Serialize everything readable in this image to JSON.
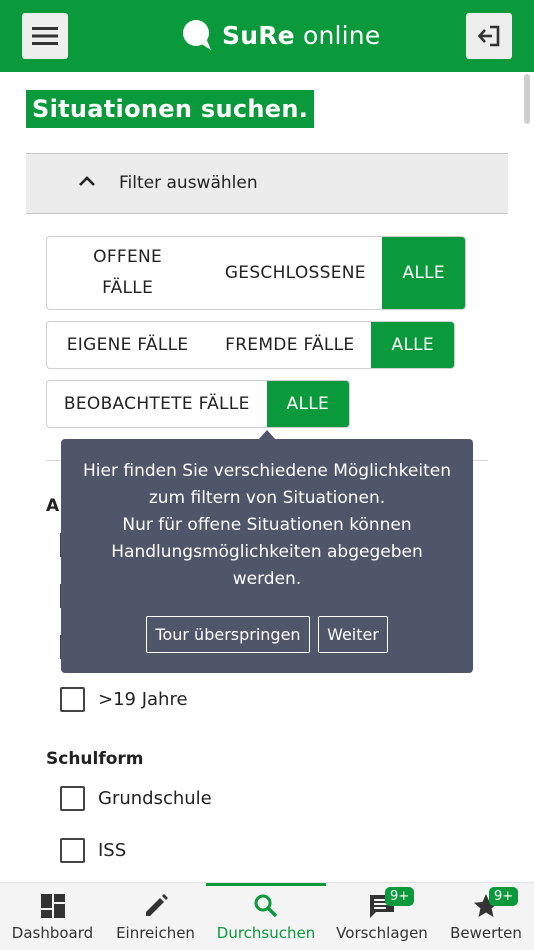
{
  "header": {
    "brand_bold": "SuRe",
    "brand_rest": " online"
  },
  "page": {
    "title": "Situationen suchen."
  },
  "filter": {
    "label": "Filter auswählen",
    "group1": [
      "OFFENE\nFÄLLE",
      "GESCHLOSSENE",
      "ALLE"
    ],
    "group2": [
      "EIGENE FÄLLE",
      "FREMDE FÄLLE",
      "ALLE"
    ],
    "group3": [
      "BEOBACHTETE FÄLLE",
      "ALLE"
    ]
  },
  "age_section": {
    "title_visible": "A",
    "last_option": ">19 Jahre"
  },
  "schulform": {
    "title": "Schulform",
    "options": [
      "Grundschule",
      "ISS"
    ]
  },
  "tooltip": {
    "line1": "Hier finden Sie verschiedene Möglichkeiten",
    "line2": "zum filtern von Situationen.",
    "line3": "Nur für offene Situationen können",
    "line4": "Handlungsmöglichkeiten abgegeben",
    "line5": "werden.",
    "skip_label": "Tour überspringen",
    "next_label": "Weiter"
  },
  "nav": {
    "items": [
      {
        "label": "Dashboard",
        "icon": "dashboard-icon"
      },
      {
        "label": "Einreichen",
        "icon": "pencil-icon"
      },
      {
        "label": "Durchsuchen",
        "icon": "search-icon"
      },
      {
        "label": "Vorschlagen",
        "icon": "comment-icon",
        "badge": "9+"
      },
      {
        "label": "Bewerten",
        "icon": "star-icon",
        "badge": "9+"
      }
    ],
    "active": "Durchsuchen"
  },
  "colors": {
    "brand_green": "#0a9a3c",
    "tooltip_bg": "#4f5669"
  }
}
